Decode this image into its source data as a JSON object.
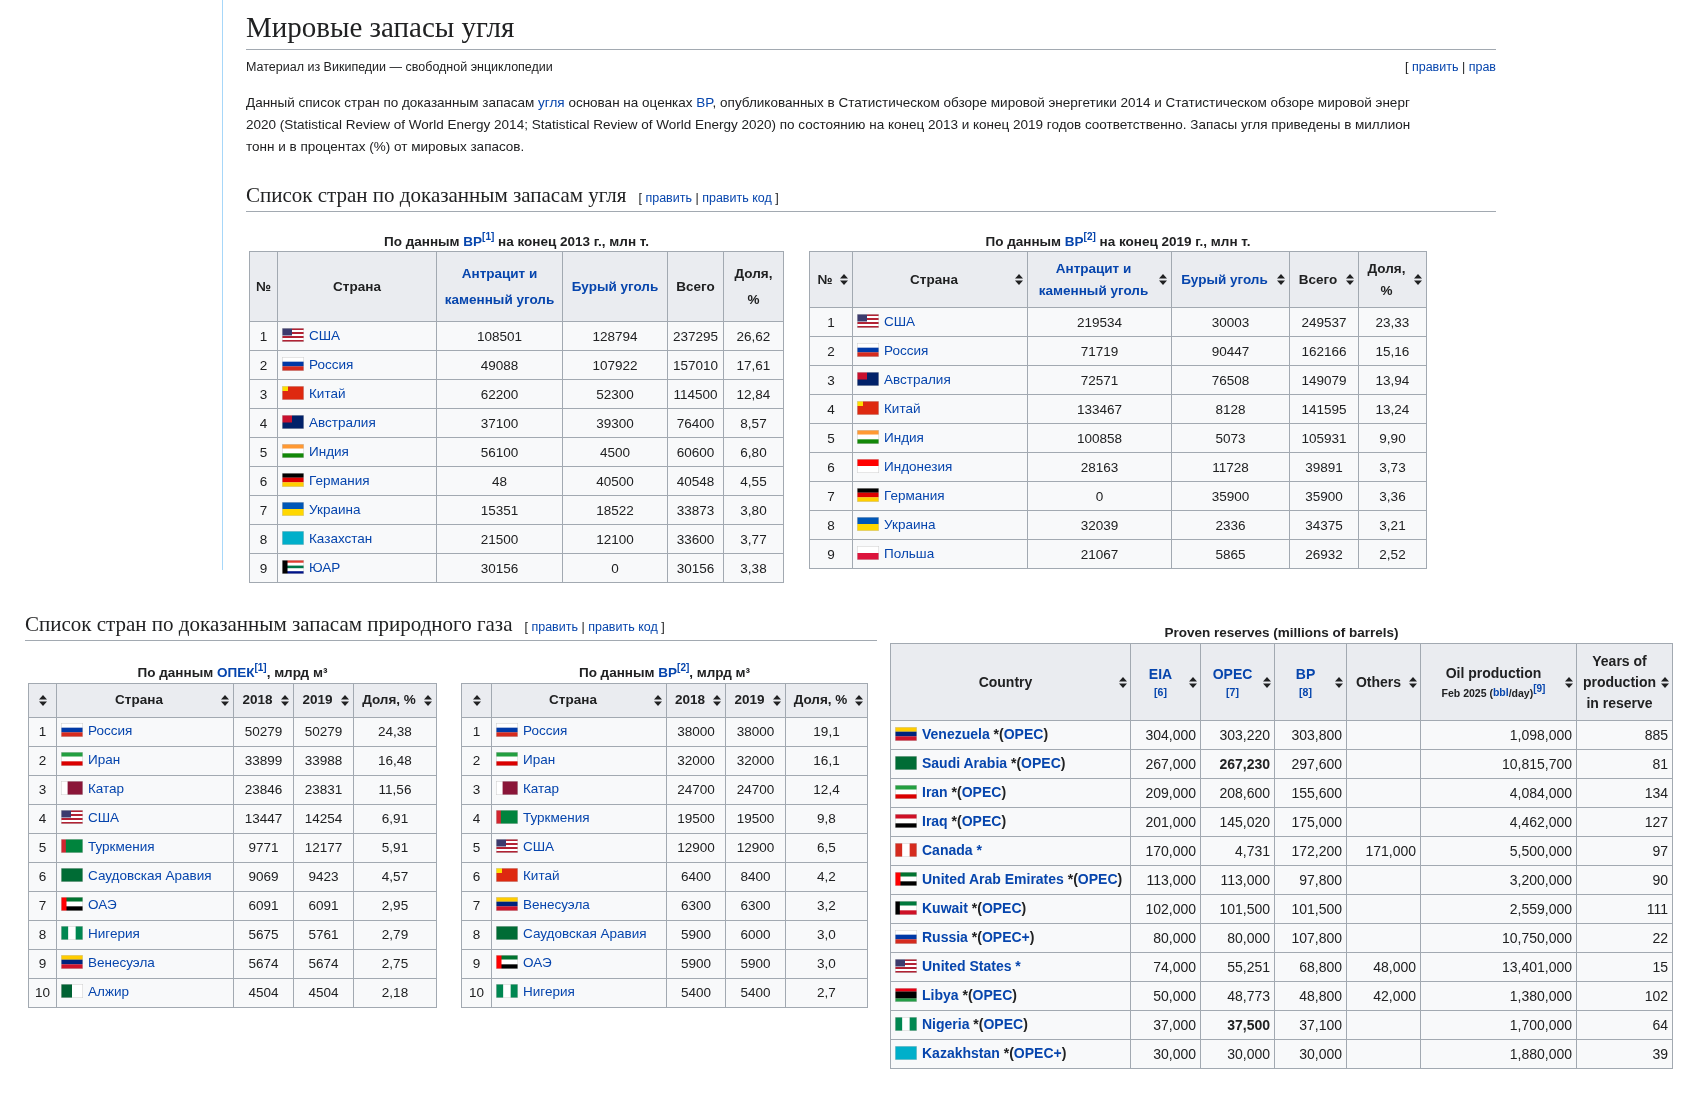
{
  "coal_page": {
    "title": "Мировые запасы угля",
    "subtitle": "Материал из Википедии — свободной энциклопедии",
    "edit_links": [
      {
        "t": "[ ",
        "kind": "text"
      },
      {
        "t": "править",
        "kind": "link"
      },
      {
        "t": " | ",
        "kind": "text"
      },
      {
        "t": "прав",
        "kind": "link"
      }
    ],
    "paragraph": [
      [
        {
          "t": "Данный список стран по доказанным запасам ",
          "kind": "text"
        },
        {
          "t": "угля",
          "kind": "link"
        },
        {
          "t": " основан на оценках ",
          "kind": "text"
        },
        {
          "t": "BP",
          "kind": "link"
        },
        {
          "t": ", опубликованных в Статистическом обзоре мировой энергетики 2014 и Статистическом обзоре мировой энерг",
          "kind": "text"
        }
      ],
      [
        {
          "t": "2020 (Statistical Review of World Energy 2014; Statistical Review of World Energy 2020) по состоянию на конец 2013 и конец 2019 годов соответственно. Запасы угля приведены в миллион",
          "kind": "text"
        }
      ],
      [
        {
          "t": "тонн и в процентах (%) от мировых запасов.",
          "kind": "text"
        }
      ]
    ],
    "section": {
      "title": "Список стран по доказанным запасам угля",
      "edit_links": [
        {
          "t": "[ ",
          "kind": "text"
        },
        {
          "t": "править",
          "kind": "link"
        },
        {
          "t": " | ",
          "kind": "text"
        },
        {
          "t": "править код",
          "kind": "link"
        },
        {
          "t": " ]",
          "kind": "text"
        }
      ]
    },
    "tables": [
      {
        "caption": [
          {
            "t": "По данным ",
            "kind": "text"
          },
          {
            "t": "BP",
            "kind": "link"
          },
          {
            "t": "[1]",
            "kind": "ref"
          },
          {
            "t": " на конец 2013 г., млн т.",
            "kind": "text"
          }
        ],
        "sortable": false,
        "headers": [
          {
            "parts": [
              {
                "t": "№",
                "kind": "text"
              }
            ]
          },
          {
            "parts": [
              {
                "t": "Страна",
                "kind": "text"
              }
            ]
          },
          {
            "parts": [
              {
                "t": "Антрацит и каменный уголь",
                "kind": "link"
              }
            ]
          },
          {
            "parts": [
              {
                "t": "Бурый уголь",
                "kind": "link"
              }
            ]
          },
          {
            "parts": [
              {
                "t": "Всего",
                "kind": "text"
              }
            ]
          },
          {
            "parts": [
              {
                "t": "Доля, %",
                "kind": "text"
              }
            ]
          }
        ],
        "rows": [
          {
            "n": "1",
            "kind": "us",
            "country": "США",
            "cells": [
              "108501",
              "128794",
              "237295",
              "26,62"
            ]
          },
          {
            "n": "2",
            "kind": "ru",
            "country": "Россия",
            "cells": [
              "49088",
              "107922",
              "157010",
              "17,61"
            ]
          },
          {
            "n": "3",
            "kind": "cn",
            "country": "Китай",
            "cells": [
              "62200",
              "52300",
              "114500",
              "12,84"
            ]
          },
          {
            "n": "4",
            "kind": "au",
            "country": "Австралия",
            "cells": [
              "37100",
              "39300",
              "76400",
              "8,57"
            ]
          },
          {
            "n": "5",
            "kind": "in",
            "country": "Индия",
            "cells": [
              "56100",
              "4500",
              "60600",
              "6,80"
            ]
          },
          {
            "n": "6",
            "kind": "de",
            "country": "Германия",
            "cells": [
              "48",
              "40500",
              "40548",
              "4,55"
            ]
          },
          {
            "n": "7",
            "kind": "ua",
            "country": "Украина",
            "cells": [
              "15351",
              "18522",
              "33873",
              "3,80"
            ]
          },
          {
            "n": "8",
            "kind": "kz",
            "country": "Казахстан",
            "cells": [
              "21500",
              "12100",
              "33600",
              "3,77"
            ]
          },
          {
            "n": "9",
            "kind": "za",
            "country": "ЮАР",
            "cells": [
              "30156",
              "0",
              "30156",
              "3,38"
            ]
          }
        ]
      },
      {
        "caption": [
          {
            "t": "По данным ",
            "kind": "text"
          },
          {
            "t": "BP",
            "kind": "link"
          },
          {
            "t": "[2]",
            "kind": "ref"
          },
          {
            "t": " на конец 2019 г., млн т.",
            "kind": "text"
          }
        ],
        "sortable": true,
        "headers": [
          {
            "parts": [
              {
                "t": "№",
                "kind": "text"
              }
            ]
          },
          {
            "parts": [
              {
                "t": "Страна",
                "kind": "text"
              }
            ]
          },
          {
            "parts": [
              {
                "t": "Антрацит и каменный уголь",
                "kind": "link"
              }
            ]
          },
          {
            "parts": [
              {
                "t": "Бурый уголь",
                "kind": "link"
              }
            ]
          },
          {
            "parts": [
              {
                "t": "Всего",
                "kind": "text"
              }
            ]
          },
          {
            "parts": [
              {
                "t": "Доля, %",
                "kind": "text"
              }
            ]
          }
        ],
        "rows": [
          {
            "n": "1",
            "kind": "us",
            "country": "США",
            "cells": [
              "219534",
              "30003",
              "249537",
              "23,33"
            ]
          },
          {
            "n": "2",
            "kind": "ru",
            "country": "Россия",
            "cells": [
              "71719",
              "90447",
              "162166",
              "15,16"
            ]
          },
          {
            "n": "3",
            "kind": "au",
            "country": "Австралия",
            "cells": [
              "72571",
              "76508",
              "149079",
              "13,94"
            ]
          },
          {
            "n": "4",
            "kind": "cn",
            "country": "Китай",
            "cells": [
              "133467",
              "8128",
              "141595",
              "13,24"
            ]
          },
          {
            "n": "5",
            "kind": "in",
            "country": "Индия",
            "cells": [
              "100858",
              "5073",
              "105931",
              "9,90"
            ]
          },
          {
            "n": "6",
            "kind": "id",
            "country": "Индонезия",
            "cells": [
              "28163",
              "11728",
              "39891",
              "3,73"
            ]
          },
          {
            "n": "7",
            "kind": "de",
            "country": "Германия",
            "cells": [
              "0",
              "35900",
              "35900",
              "3,36"
            ]
          },
          {
            "n": "8",
            "kind": "ua",
            "country": "Украина",
            "cells": [
              "32039",
              "2336",
              "34375",
              "3,21"
            ]
          },
          {
            "n": "9",
            "kind": "pl",
            "country": "Польша",
            "cells": [
              "21067",
              "5865",
              "26932",
              "2,52"
            ]
          }
        ]
      }
    ]
  },
  "gas_page": {
    "section": {
      "title": "Список стран по доказанным запасам природного газа",
      "edit_links": [
        {
          "t": "[ ",
          "kind": "text"
        },
        {
          "t": "править",
          "kind": "link"
        },
        {
          "t": " | ",
          "kind": "text"
        },
        {
          "t": "править код",
          "kind": "link"
        },
        {
          "t": " ]",
          "kind": "text"
        }
      ]
    },
    "tables": [
      {
        "caption": [
          {
            "t": "По данным ",
            "kind": "text"
          },
          {
            "t": "ОПЕК",
            "kind": "link"
          },
          {
            "t": "[1]",
            "kind": "ref"
          },
          {
            "t": ", млрд м³",
            "kind": "text"
          }
        ],
        "sortable": true,
        "headers": [
          {
            "parts": [
              {
                "t": "Страна",
                "kind": "text"
              }
            ]
          },
          {
            "parts": [
              {
                "t": "2018",
                "kind": "text"
              }
            ]
          },
          {
            "parts": [
              {
                "t": "2019",
                "kind": "text"
              }
            ]
          },
          {
            "parts": [
              {
                "t": "Доля, %",
                "kind": "text"
              }
            ]
          }
        ],
        "rows": [
          {
            "n": "1",
            "kind": "ru",
            "country": "Россия",
            "cells": [
              "50279",
              "50279",
              "24,38"
            ]
          },
          {
            "n": "2",
            "kind": "ir",
            "country": "Иран",
            "cells": [
              "33899",
              "33988",
              "16,48"
            ]
          },
          {
            "n": "3",
            "kind": "qa",
            "country": "Катар",
            "cells": [
              "23846",
              "23831",
              "11,56"
            ]
          },
          {
            "n": "4",
            "kind": "us",
            "country": "США",
            "cells": [
              "13447",
              "14254",
              "6,91"
            ]
          },
          {
            "n": "5",
            "kind": "tm",
            "country": "Туркмения",
            "cells": [
              "9771",
              "12177",
              "5,91"
            ]
          },
          {
            "n": "6",
            "kind": "sa",
            "country": "Саудовская Аравия",
            "cells": [
              "9069",
              "9423",
              "4,57"
            ]
          },
          {
            "n": "7",
            "kind": "ae",
            "country": "ОАЭ",
            "cells": [
              "6091",
              "6091",
              "2,95"
            ]
          },
          {
            "n": "8",
            "kind": "ng",
            "country": "Нигерия",
            "cells": [
              "5675",
              "5761",
              "2,79"
            ]
          },
          {
            "n": "9",
            "kind": "ve",
            "country": "Венесуэла",
            "cells": [
              "5674",
              "5674",
              "2,75"
            ]
          },
          {
            "n": "10",
            "kind": "dz",
            "country": "Алжир",
            "cells": [
              "4504",
              "4504",
              "2,18"
            ]
          }
        ]
      },
      {
        "caption": [
          {
            "t": "По данным ",
            "kind": "text"
          },
          {
            "t": "BP",
            "kind": "link"
          },
          {
            "t": "[2]",
            "kind": "ref"
          },
          {
            "t": ", млрд м³",
            "kind": "text"
          }
        ],
        "sortable": true,
        "headers": [
          {
            "parts": [
              {
                "t": "Страна",
                "kind": "text"
              }
            ]
          },
          {
            "parts": [
              {
                "t": "2018",
                "kind": "text"
              }
            ]
          },
          {
            "parts": [
              {
                "t": "2019",
                "kind": "text"
              }
            ]
          },
          {
            "parts": [
              {
                "t": "Доля, %",
                "kind": "text"
              }
            ]
          }
        ],
        "rows": [
          {
            "n": "1",
            "kind": "ru",
            "country": "Россия",
            "cells": [
              "38000",
              "38000",
              "19,1"
            ]
          },
          {
            "n": "2",
            "kind": "ir",
            "country": "Иран",
            "cells": [
              "32000",
              "32000",
              "16,1"
            ]
          },
          {
            "n": "3",
            "kind": "qa",
            "country": "Катар",
            "cells": [
              "24700",
              "24700",
              "12,4"
            ]
          },
          {
            "n": "4",
            "kind": "tm",
            "country": "Туркмения",
            "cells": [
              "19500",
              "19500",
              "9,8"
            ]
          },
          {
            "n": "5",
            "kind": "us",
            "country": "США",
            "cells": [
              "12900",
              "12900",
              "6,5"
            ]
          },
          {
            "n": "6",
            "kind": "cn",
            "country": "Китай",
            "cells": [
              "6400",
              "8400",
              "4,2"
            ]
          },
          {
            "n": "7",
            "kind": "ve",
            "country": "Венесуэла",
            "cells": [
              "6300",
              "6300",
              "3,2"
            ]
          },
          {
            "n": "8",
            "kind": "sa",
            "country": "Саудовская Аравия",
            "cells": [
              "5900",
              "6000",
              "3,0"
            ]
          },
          {
            "n": "9",
            "kind": "ae",
            "country": "ОАЭ",
            "cells": [
              "5900",
              "5900",
              "3,0"
            ]
          },
          {
            "n": "10",
            "kind": "ng",
            "country": "Нигерия",
            "cells": [
              "5400",
              "5400",
              "2,7"
            ]
          }
        ]
      }
    ]
  },
  "oil_table": {
    "caption": "Proven reserves (millions of barrels)",
    "sortable": true,
    "headers": [
      {
        "parts": [
          {
            "t": "Country",
            "kind": "text"
          }
        ]
      },
      {
        "parts": [
          {
            "t": "EIA",
            "kind": "link"
          }
        ],
        "sub": [
          {
            "t": "[6]",
            "kind": "link"
          }
        ]
      },
      {
        "parts": [
          {
            "t": "OPEC",
            "kind": "link"
          }
        ],
        "sub": [
          {
            "t": "[7]",
            "kind": "link"
          }
        ]
      },
      {
        "parts": [
          {
            "t": "BP",
            "kind": "link"
          }
        ],
        "sub": [
          {
            "t": "[8]",
            "kind": "link"
          }
        ]
      },
      {
        "parts": [
          {
            "t": "Others",
            "kind": "text"
          }
        ]
      },
      {
        "parts": [
          {
            "t": "Oil production",
            "kind": "text"
          }
        ],
        "sub": [
          {
            "t": "Feb 2025 (",
            "kind": "text"
          },
          {
            "t": "bbl",
            "kind": "link"
          },
          {
            "t": "/day)",
            "kind": "text"
          },
          {
            "t": "[9]",
            "kind": "ref"
          }
        ]
      },
      {
        "parts": [
          {
            "t": "Years of production in reserve",
            "kind": "text"
          }
        ]
      }
    ],
    "rows": [
      {
        "kind": "ve",
        "country": [
          {
            "t": "Venezuela",
            "kind": "link"
          },
          {
            "t": " *(",
            "kind": "text"
          },
          {
            "t": "OPEC",
            "kind": "link"
          },
          {
            "t": ")",
            "kind": "text"
          }
        ],
        "eia": "304,000",
        "opec": "303,220",
        "opec_bold": false,
        "bp": "303,800",
        "production": "1,098,000",
        "years": "885"
      },
      {
        "kind": "sa",
        "country": [
          {
            "t": "Saudi Arabia",
            "kind": "link"
          },
          {
            "t": " *(",
            "kind": "text"
          },
          {
            "t": "OPEC",
            "kind": "link"
          },
          {
            "t": ")",
            "kind": "text"
          }
        ],
        "eia": "267,000",
        "opec": "267,230",
        "opec_bold": true,
        "bp": "297,600",
        "production": "10,815,700",
        "years": "81"
      },
      {
        "kind": "ir",
        "country": [
          {
            "t": "Iran",
            "kind": "link"
          },
          {
            "t": " *(",
            "kind": "text"
          },
          {
            "t": "OPEC",
            "kind": "link"
          },
          {
            "t": ")",
            "kind": "text"
          }
        ],
        "eia": "209,000",
        "opec": "208,600",
        "opec_bold": false,
        "bp": "155,600",
        "production": "4,084,000",
        "years": "134"
      },
      {
        "kind": "iq",
        "country": [
          {
            "t": "Iraq",
            "kind": "link"
          },
          {
            "t": " *(",
            "kind": "text"
          },
          {
            "t": "OPEC",
            "kind": "link"
          },
          {
            "t": ")",
            "kind": "text"
          }
        ],
        "eia": "201,000",
        "opec": "145,020",
        "opec_bold": false,
        "bp": "175,000",
        "production": "4,462,000",
        "years": "127"
      },
      {
        "kind": "ca",
        "country": [
          {
            "t": "Canada",
            "kind": "link"
          },
          {
            "t": " *",
            "kind": "link"
          }
        ],
        "eia": "170,000",
        "opec": "4,731",
        "opec_bold": false,
        "bp": "172,200",
        "others": "171,000",
        "production": "5,500,000",
        "years": "97"
      },
      {
        "kind": "ae",
        "country": [
          {
            "t": "United Arab Emirates",
            "kind": "link"
          },
          {
            "t": " *(",
            "kind": "text"
          },
          {
            "t": "OPEC",
            "kind": "link"
          },
          {
            "t": ")",
            "kind": "text"
          }
        ],
        "eia": "113,000",
        "opec": "113,000",
        "opec_bold": false,
        "bp": "97,800",
        "production": "3,200,000",
        "years": "90"
      },
      {
        "kind": "kw",
        "country": [
          {
            "t": "Kuwait",
            "kind": "link"
          },
          {
            "t": " *(",
            "kind": "text"
          },
          {
            "t": "OPEC",
            "kind": "link"
          },
          {
            "t": ")",
            "kind": "text"
          }
        ],
        "eia": "102,000",
        "opec": "101,500",
        "opec_bold": false,
        "bp": "101,500",
        "production": "2,559,000",
        "years": "111"
      },
      {
        "kind": "ru",
        "country": [
          {
            "t": "Russia",
            "kind": "link"
          },
          {
            "t": " *(",
            "kind": "text"
          },
          {
            "t": "OPEC+",
            "kind": "link"
          },
          {
            "t": ")",
            "kind": "text"
          }
        ],
        "eia": "80,000",
        "opec": "80,000",
        "opec_bold": false,
        "bp": "107,800",
        "production": "10,750,000",
        "years": "22"
      },
      {
        "kind": "us",
        "country": [
          {
            "t": "United States",
            "kind": "link"
          },
          {
            "t": " *",
            "kind": "link"
          }
        ],
        "eia": "74,000",
        "opec": "55,251",
        "opec_bold": false,
        "bp": "68,800",
        "others": "48,000",
        "production": "13,401,000",
        "years": "15"
      },
      {
        "kind": "ly",
        "country": [
          {
            "t": "Libya",
            "kind": "link"
          },
          {
            "t": " *(",
            "kind": "text"
          },
          {
            "t": "OPEC",
            "kind": "link"
          },
          {
            "t": ")",
            "kind": "text"
          }
        ],
        "eia": "50,000",
        "opec": "48,773",
        "opec_bold": false,
        "bp": "48,800",
        "others": "42,000",
        "production": "1,380,000",
        "years": "102"
      },
      {
        "kind": "ng",
        "country": [
          {
            "t": "Nigeria",
            "kind": "link"
          },
          {
            "t": " *(",
            "kind": "text"
          },
          {
            "t": "OPEC",
            "kind": "link"
          },
          {
            "t": ")",
            "kind": "text"
          }
        ],
        "eia": "37,000",
        "opec": "37,500",
        "opec_bold": true,
        "bp": "37,100",
        "production": "1,700,000",
        "years": "64"
      },
      {
        "kind": "kz",
        "country": [
          {
            "t": "Kazakhstan",
            "kind": "link"
          },
          {
            "t": " *(",
            "kind": "text"
          },
          {
            "t": "OPEC+",
            "kind": "link"
          },
          {
            "t": ")",
            "kind": "text"
          }
        ],
        "eia": "30,000",
        "opec": "30,000",
        "opec_bold": false,
        "bp": "30,000",
        "production": "1,880,000",
        "years": "39"
      }
    ]
  }
}
